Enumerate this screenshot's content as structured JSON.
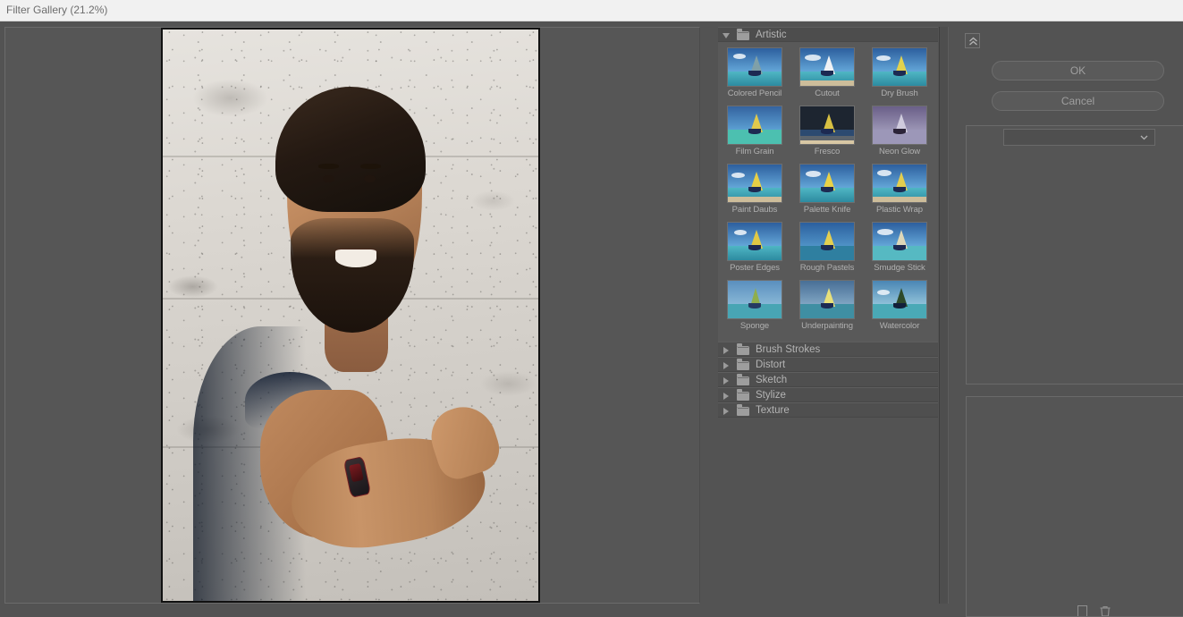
{
  "titlebar": {
    "label": "Filter Gallery (21.2%)"
  },
  "preview": {
    "zoom": "21.2%",
    "image_description": "Portrait photo of a smiling bearded man with crossed arms wearing a blue t-shirt in front of a textured white concrete wall"
  },
  "filter_panel": {
    "categories": [
      {
        "name": "Artistic",
        "expanded": true,
        "filters": [
          "Colored Pencil",
          "Cutout",
          "Dry Brush",
          "Film Grain",
          "Fresco",
          "Neon Glow",
          "Paint Daubs",
          "Palette Knife",
          "Plastic Wrap",
          "Poster Edges",
          "Rough Pastels",
          "Smudge Stick",
          "Sponge",
          "Underpainting",
          "Watercolor"
        ]
      },
      {
        "name": "Brush Strokes",
        "expanded": false,
        "filters": []
      },
      {
        "name": "Distort",
        "expanded": false,
        "filters": []
      },
      {
        "name": "Sketch",
        "expanded": false,
        "filters": []
      },
      {
        "name": "Stylize",
        "expanded": false,
        "filters": []
      },
      {
        "name": "Texture",
        "expanded": false,
        "filters": []
      }
    ]
  },
  "right_panel": {
    "ok_label": "OK",
    "cancel_label": "Cancel",
    "collapse_icon": "double-chevron-up-icon",
    "filter_select_value": "",
    "filter_select_icon": "chevron-down-icon",
    "new_effect_icon": "new-effect-layer-icon",
    "delete_effect_icon": "delete-effect-layer-icon"
  },
  "colors": {
    "titlebar_bg": "#f1f1f1",
    "titlebar_text": "#6d6d6d",
    "app_bg": "#535353",
    "panel_bg": "#595959",
    "header_bg": "#4f4f4f",
    "label_text": "#b0b0b0",
    "button_text": "#9f9f9f",
    "border": "#6a6a6a"
  }
}
